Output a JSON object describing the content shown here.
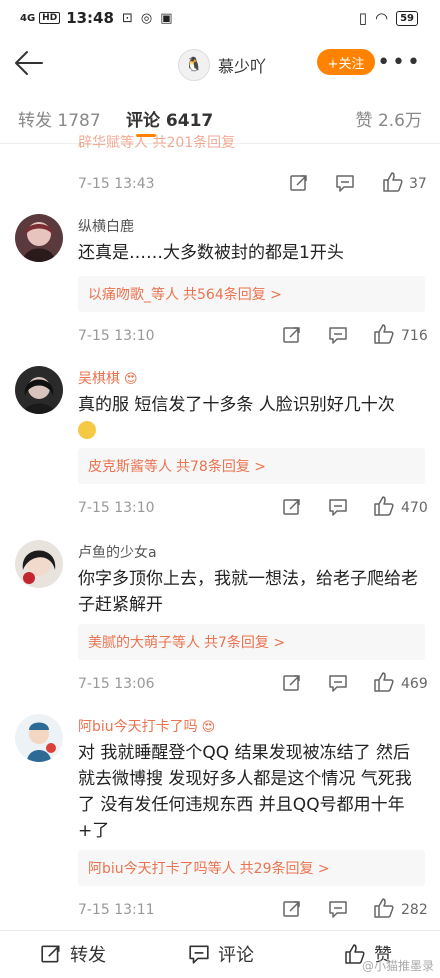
{
  "status_bar": {
    "signal": "4G",
    "hd": "HD",
    "time": "13:48",
    "battery": "59"
  },
  "nav": {
    "author_name": "慕少吖",
    "follow_label": "+关注"
  },
  "tabs": {
    "repost": "转发 1787",
    "comment": "评论 6417",
    "like": "赞 2.6万"
  },
  "clipped_reply": "辟华赋等人 共201条回复",
  "comments": [
    {
      "time": "7-15 13:43",
      "likes": "37"
    },
    {
      "name": "纵横白鹿",
      "text": "还真是……大多数被封的都是1开头",
      "reply_names": "以痛吻歌_等人",
      "reply_count": "共564条回复 >",
      "time": "7-15 13:10",
      "likes": "716"
    },
    {
      "name": "吴棋棋",
      "text": "真的服 短信发了十多条 人脸识别好几十次",
      "reply_names": "皮克斯酱等人",
      "reply_count": "共78条回复 >",
      "time": "7-15 13:10",
      "likes": "470"
    },
    {
      "name": "卢鱼的少女a",
      "text": "你字多顶你上去，我就一想法，给老子爬给老子赶紧解开",
      "reply_names": "美腻的大萌子等人",
      "reply_count": "共7条回复 >",
      "time": "7-15 13:06",
      "likes": "469"
    },
    {
      "name": "阿biu今天打卡了吗",
      "text": "对 我就睡醒登个QQ 结果发现被冻结了 然后就去微博搜 发现好多人都是这个情况 气死我了 没有发任何违规东西 并且QQ号都用十年+了",
      "reply_names": "阿biu今天打卡了吗等人",
      "reply_count": "共29条回复 >",
      "time": "7-15 13:11",
      "likes": "282"
    }
  ],
  "bottom_bar": {
    "repost": "转发",
    "comment": "评论",
    "like": "赞",
    "watermark": "@小猫推墨录"
  },
  "colors": {
    "accent": "#ff8200",
    "link": "#eb7350"
  }
}
